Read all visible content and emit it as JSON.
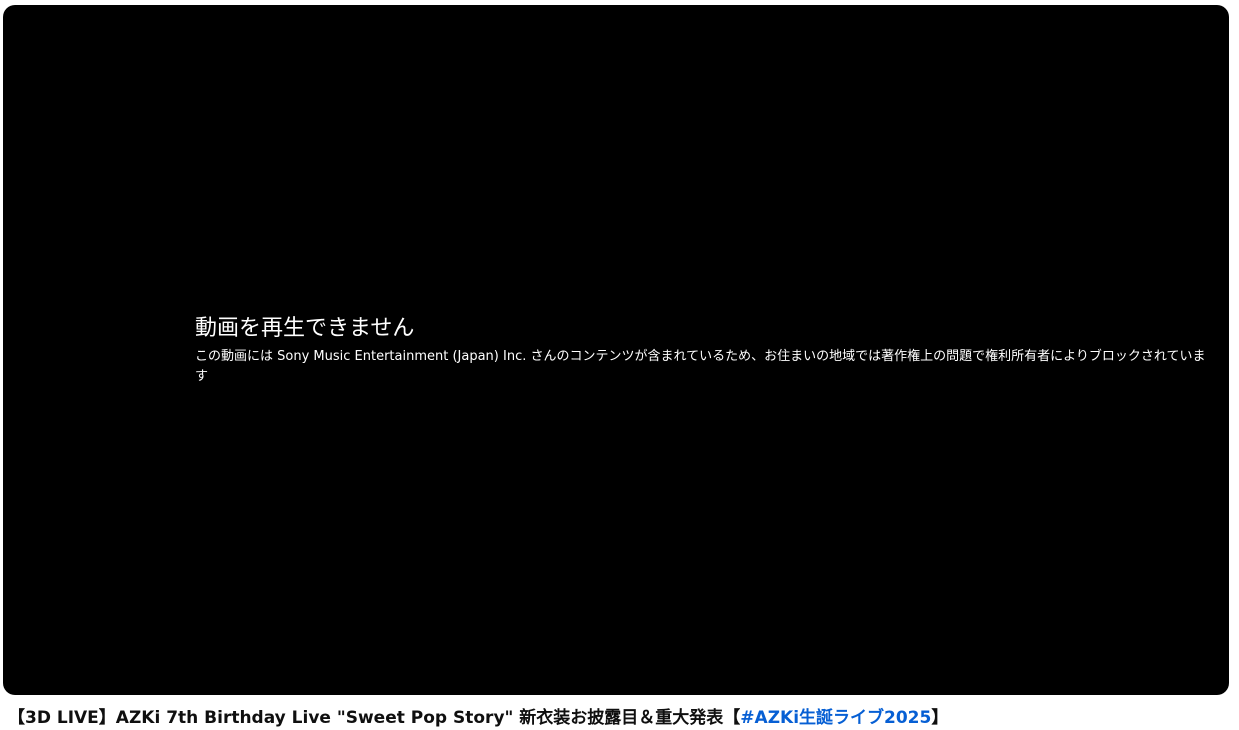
{
  "player": {
    "error_title": "動画を再生できません",
    "error_reason": "この動画には Sony Music Entertainment (Japan) Inc. さんのコンテンツが含まれているため、お住まいの地域では著作権上の問題で権利所有者によりブロックされています"
  },
  "video": {
    "title_prefix": "【3D LIVE】AZKi 7th Birthday Live \"Sweet Pop Story\" 新衣装お披露目＆重大発表【",
    "hashtag": "#AZKi生誕ライブ2025",
    "title_suffix": "】"
  },
  "colors": {
    "player_bg": "#000000",
    "hashtag_link": "#065fd4",
    "title_text": "#0f0f0f"
  }
}
